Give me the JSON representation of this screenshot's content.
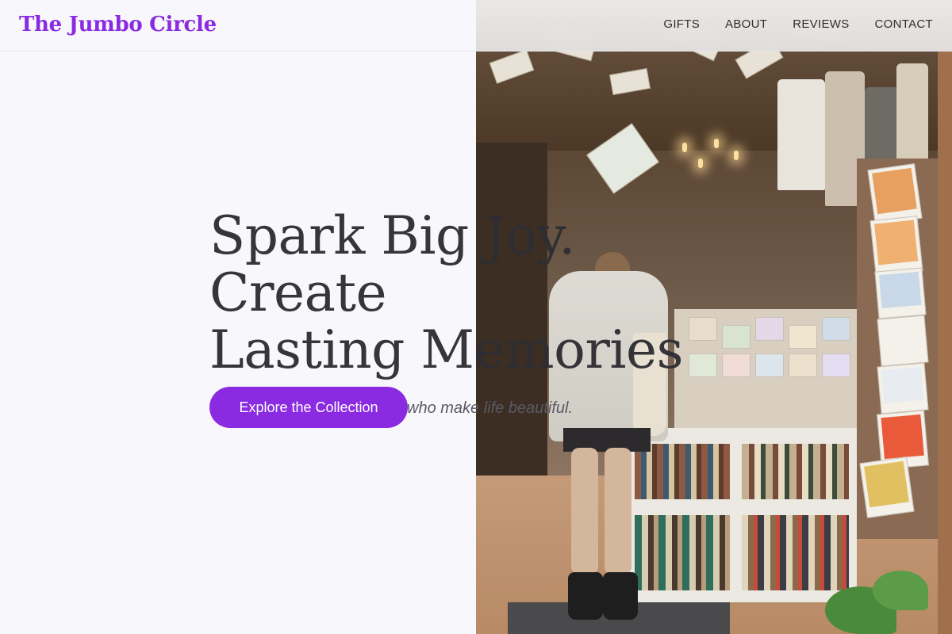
{
  "header": {
    "brand": "The Jumbo Circle",
    "nav": [
      {
        "label": "GIFTS"
      },
      {
        "label": "ABOUT"
      },
      {
        "label": "REVIEWS"
      },
      {
        "label": "CONTACT"
      }
    ]
  },
  "hero": {
    "title_line1": "Spark Big Joy. Create",
    "title_line2": "Lasting Memories",
    "subtitle": "Curated treasures for those who make life beautiful.",
    "cta_label": "Explore the Collection"
  },
  "colors": {
    "accent": "#8a2be2",
    "background": "#f8f8fc",
    "text": "#2e2e33"
  }
}
